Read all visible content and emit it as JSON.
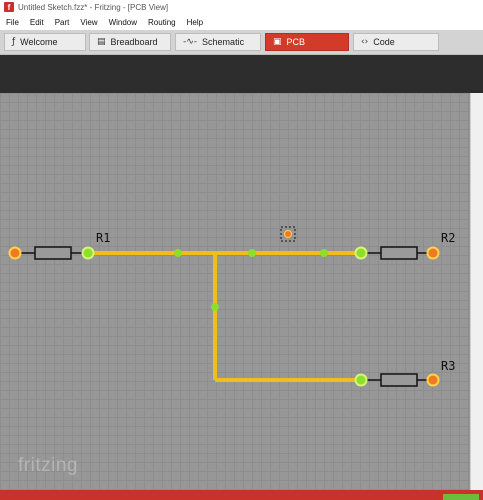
{
  "window": {
    "title": "Untitled Sketch.fzz* - Fritzing - [PCB View]",
    "app_icon_letter": "f"
  },
  "menu": [
    "File",
    "Edit",
    "Part",
    "View",
    "Window",
    "Routing",
    "Help"
  ],
  "tabs": [
    {
      "label": "Welcome",
      "icon": "fritzing-f-icon",
      "glyph": "ƒ",
      "active": false
    },
    {
      "label": "Breadboard",
      "icon": "breadboard-icon",
      "glyph": "▤",
      "active": false
    },
    {
      "label": "Schematic",
      "icon": "schematic-icon",
      "glyph": "-∿-",
      "active": false
    },
    {
      "label": "PCB",
      "icon": "pcb-icon",
      "glyph": "▣",
      "active": true
    },
    {
      "label": "Code",
      "icon": "code-icon",
      "glyph": "‹›",
      "active": false
    }
  ],
  "canvas": {
    "brand": "fritzing",
    "parts": [
      {
        "ref": "R1"
      },
      {
        "ref": "R2"
      },
      {
        "ref": "R3"
      }
    ]
  },
  "colors": {
    "accent_active_tab": "#d23a2a",
    "trace": "#f2bd1c",
    "connector_green": "#8be02a",
    "connector_red": "#f07a22",
    "canvas_bg": "#979797"
  }
}
